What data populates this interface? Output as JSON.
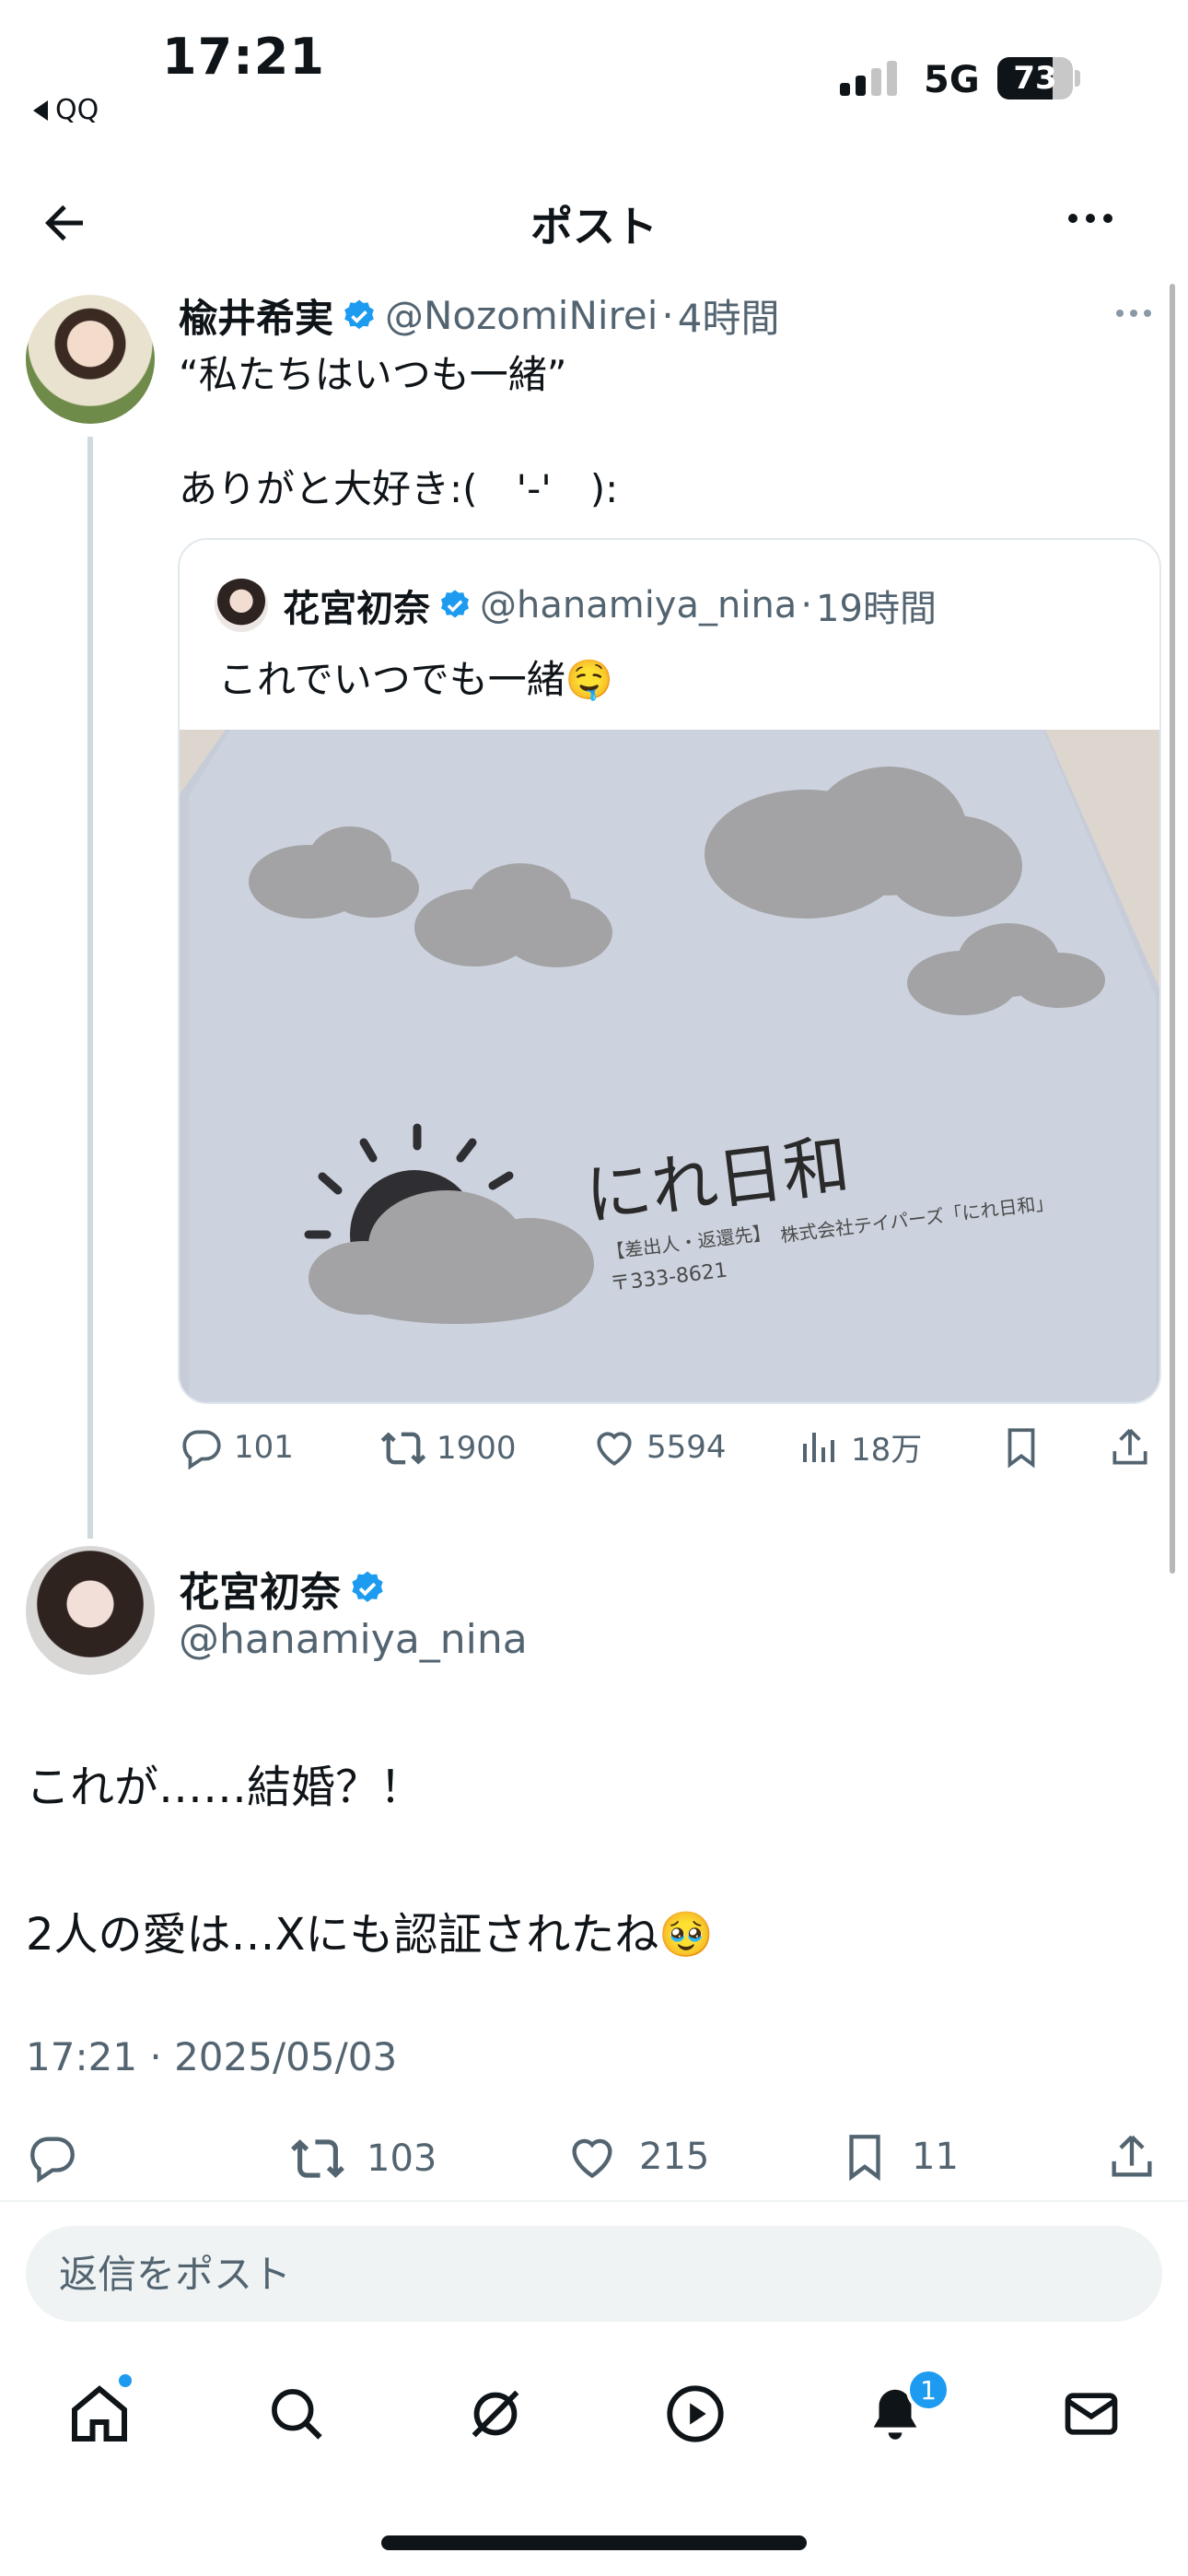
{
  "status": {
    "time": "17:21",
    "back_app": "QQ",
    "network": "5G",
    "battery": "73",
    "battery_level_percent": 73
  },
  "header": {
    "title": "ポスト"
  },
  "parent_post": {
    "author_name": "楡井希実",
    "handle": "@NozomiNirei",
    "time_sep": "·",
    "time": "4時間",
    "text": "“私たちはいつも一緒”\n\nありがと大好き:(　'-'　):",
    "quote": {
      "author_name": "花宮初奈",
      "handle": "@hanamiya_nina",
      "time_sep": "·",
      "time": "19時間",
      "text": "これでいつでも一緒🤤",
      "image": {
        "brand": "にれ日和",
        "line1": "【差出人・返還先】",
        "line2": "株式会社テイパーズ「にれ日和」",
        "postal": "〒333-8621"
      }
    },
    "stats": {
      "replies": "101",
      "reposts": "1900",
      "likes": "5594",
      "views": "18万"
    }
  },
  "main_post": {
    "author_name": "花宮初奈",
    "handle": "@hanamiya_nina",
    "text": "これが……結婚？！\n\n2人の愛は…Xにも認証されたね🥹",
    "timestamp": "17:21 · 2025/05/03",
    "stats": {
      "reposts": "103",
      "likes": "215",
      "bookmarks": "11"
    }
  },
  "reply": {
    "placeholder": "返信をポスト"
  },
  "tabbar": {
    "notifications_badge": "1"
  },
  "colors": {
    "accent": "#1d9bf0",
    "text": "#0f1419",
    "muted": "#536471"
  }
}
